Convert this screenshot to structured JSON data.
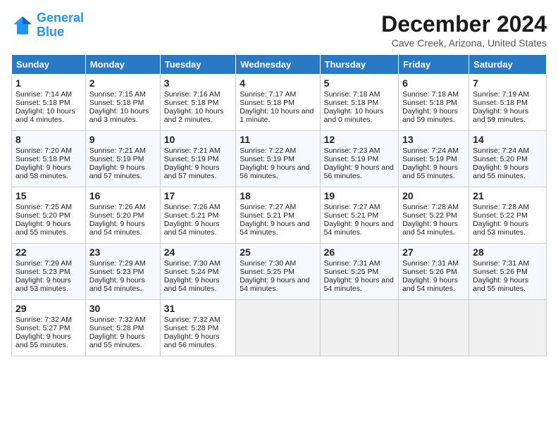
{
  "logo": {
    "line1": "General",
    "line2": "Blue"
  },
  "title": "December 2024",
  "subtitle": "Cave Creek, Arizona, United States",
  "days_of_week": [
    "Sunday",
    "Monday",
    "Tuesday",
    "Wednesday",
    "Thursday",
    "Friday",
    "Saturday"
  ],
  "weeks": [
    [
      {
        "day": "1",
        "sunrise": "Sunrise: 7:14 AM",
        "sunset": "Sunset: 5:18 PM",
        "daylight": "Daylight: 10 hours and 4 minutes."
      },
      {
        "day": "2",
        "sunrise": "Sunrise: 7:15 AM",
        "sunset": "Sunset: 5:18 PM",
        "daylight": "Daylight: 10 hours and 3 minutes."
      },
      {
        "day": "3",
        "sunrise": "Sunrise: 7:16 AM",
        "sunset": "Sunset: 5:18 PM",
        "daylight": "Daylight: 10 hours and 2 minutes."
      },
      {
        "day": "4",
        "sunrise": "Sunrise: 7:17 AM",
        "sunset": "Sunset: 5:18 PM",
        "daylight": "Daylight: 10 hours and 1 minute."
      },
      {
        "day": "5",
        "sunrise": "Sunrise: 7:18 AM",
        "sunset": "Sunset: 5:18 PM",
        "daylight": "Daylight: 10 hours and 0 minutes."
      },
      {
        "day": "6",
        "sunrise": "Sunrise: 7:18 AM",
        "sunset": "Sunset: 5:18 PM",
        "daylight": "Daylight: 9 hours and 59 minutes."
      },
      {
        "day": "7",
        "sunrise": "Sunrise: 7:19 AM",
        "sunset": "Sunset: 5:18 PM",
        "daylight": "Daylight: 9 hours and 59 minutes."
      }
    ],
    [
      {
        "day": "8",
        "sunrise": "Sunrise: 7:20 AM",
        "sunset": "Sunset: 5:18 PM",
        "daylight": "Daylight: 9 hours and 58 minutes."
      },
      {
        "day": "9",
        "sunrise": "Sunrise: 7:21 AM",
        "sunset": "Sunset: 5:19 PM",
        "daylight": "Daylight: 9 hours and 57 minutes."
      },
      {
        "day": "10",
        "sunrise": "Sunrise: 7:21 AM",
        "sunset": "Sunset: 5:19 PM",
        "daylight": "Daylight: 9 hours and 57 minutes."
      },
      {
        "day": "11",
        "sunrise": "Sunrise: 7:22 AM",
        "sunset": "Sunset: 5:19 PM",
        "daylight": "Daylight: 9 hours and 56 minutes."
      },
      {
        "day": "12",
        "sunrise": "Sunrise: 7:23 AM",
        "sunset": "Sunset: 5:19 PM",
        "daylight": "Daylight: 9 hours and 56 minutes."
      },
      {
        "day": "13",
        "sunrise": "Sunrise: 7:24 AM",
        "sunset": "Sunset: 5:19 PM",
        "daylight": "Daylight: 9 hours and 55 minutes."
      },
      {
        "day": "14",
        "sunrise": "Sunrise: 7:24 AM",
        "sunset": "Sunset: 5:20 PM",
        "daylight": "Daylight: 9 hours and 55 minutes."
      }
    ],
    [
      {
        "day": "15",
        "sunrise": "Sunrise: 7:25 AM",
        "sunset": "Sunset: 5:20 PM",
        "daylight": "Daylight: 9 hours and 55 minutes."
      },
      {
        "day": "16",
        "sunrise": "Sunrise: 7:26 AM",
        "sunset": "Sunset: 5:20 PM",
        "daylight": "Daylight: 9 hours and 54 minutes."
      },
      {
        "day": "17",
        "sunrise": "Sunrise: 7:26 AM",
        "sunset": "Sunset: 5:21 PM",
        "daylight": "Daylight: 9 hours and 54 minutes."
      },
      {
        "day": "18",
        "sunrise": "Sunrise: 7:27 AM",
        "sunset": "Sunset: 5:21 PM",
        "daylight": "Daylight: 9 hours and 54 minutes."
      },
      {
        "day": "19",
        "sunrise": "Sunrise: 7:27 AM",
        "sunset": "Sunset: 5:21 PM",
        "daylight": "Daylight: 9 hours and 54 minutes."
      },
      {
        "day": "20",
        "sunrise": "Sunrise: 7:28 AM",
        "sunset": "Sunset: 5:22 PM",
        "daylight": "Daylight: 9 hours and 54 minutes."
      },
      {
        "day": "21",
        "sunrise": "Sunrise: 7:28 AM",
        "sunset": "Sunset: 5:22 PM",
        "daylight": "Daylight: 9 hours and 53 minutes."
      }
    ],
    [
      {
        "day": "22",
        "sunrise": "Sunrise: 7:29 AM",
        "sunset": "Sunset: 5:23 PM",
        "daylight": "Daylight: 9 hours and 53 minutes."
      },
      {
        "day": "23",
        "sunrise": "Sunrise: 7:29 AM",
        "sunset": "Sunset: 5:23 PM",
        "daylight": "Daylight: 9 hours and 54 minutes."
      },
      {
        "day": "24",
        "sunrise": "Sunrise: 7:30 AM",
        "sunset": "Sunset: 5:24 PM",
        "daylight": "Daylight: 9 hours and 54 minutes."
      },
      {
        "day": "25",
        "sunrise": "Sunrise: 7:30 AM",
        "sunset": "Sunset: 5:25 PM",
        "daylight": "Daylight: 9 hours and 54 minutes."
      },
      {
        "day": "26",
        "sunrise": "Sunrise: 7:31 AM",
        "sunset": "Sunset: 5:25 PM",
        "daylight": "Daylight: 9 hours and 54 minutes."
      },
      {
        "day": "27",
        "sunrise": "Sunrise: 7:31 AM",
        "sunset": "Sunset: 5:26 PM",
        "daylight": "Daylight: 9 hours and 54 minutes."
      },
      {
        "day": "28",
        "sunrise": "Sunrise: 7:31 AM",
        "sunset": "Sunset: 5:26 PM",
        "daylight": "Daylight: 9 hours and 55 minutes."
      }
    ],
    [
      {
        "day": "29",
        "sunrise": "Sunrise: 7:32 AM",
        "sunset": "Sunset: 5:27 PM",
        "daylight": "Daylight: 9 hours and 55 minutes."
      },
      {
        "day": "30",
        "sunrise": "Sunrise: 7:32 AM",
        "sunset": "Sunset: 5:28 PM",
        "daylight": "Daylight: 9 hours and 55 minutes."
      },
      {
        "day": "31",
        "sunrise": "Sunrise: 7:32 AM",
        "sunset": "Sunset: 5:28 PM",
        "daylight": "Daylight: 9 hours and 56 minutes."
      },
      null,
      null,
      null,
      null
    ]
  ]
}
